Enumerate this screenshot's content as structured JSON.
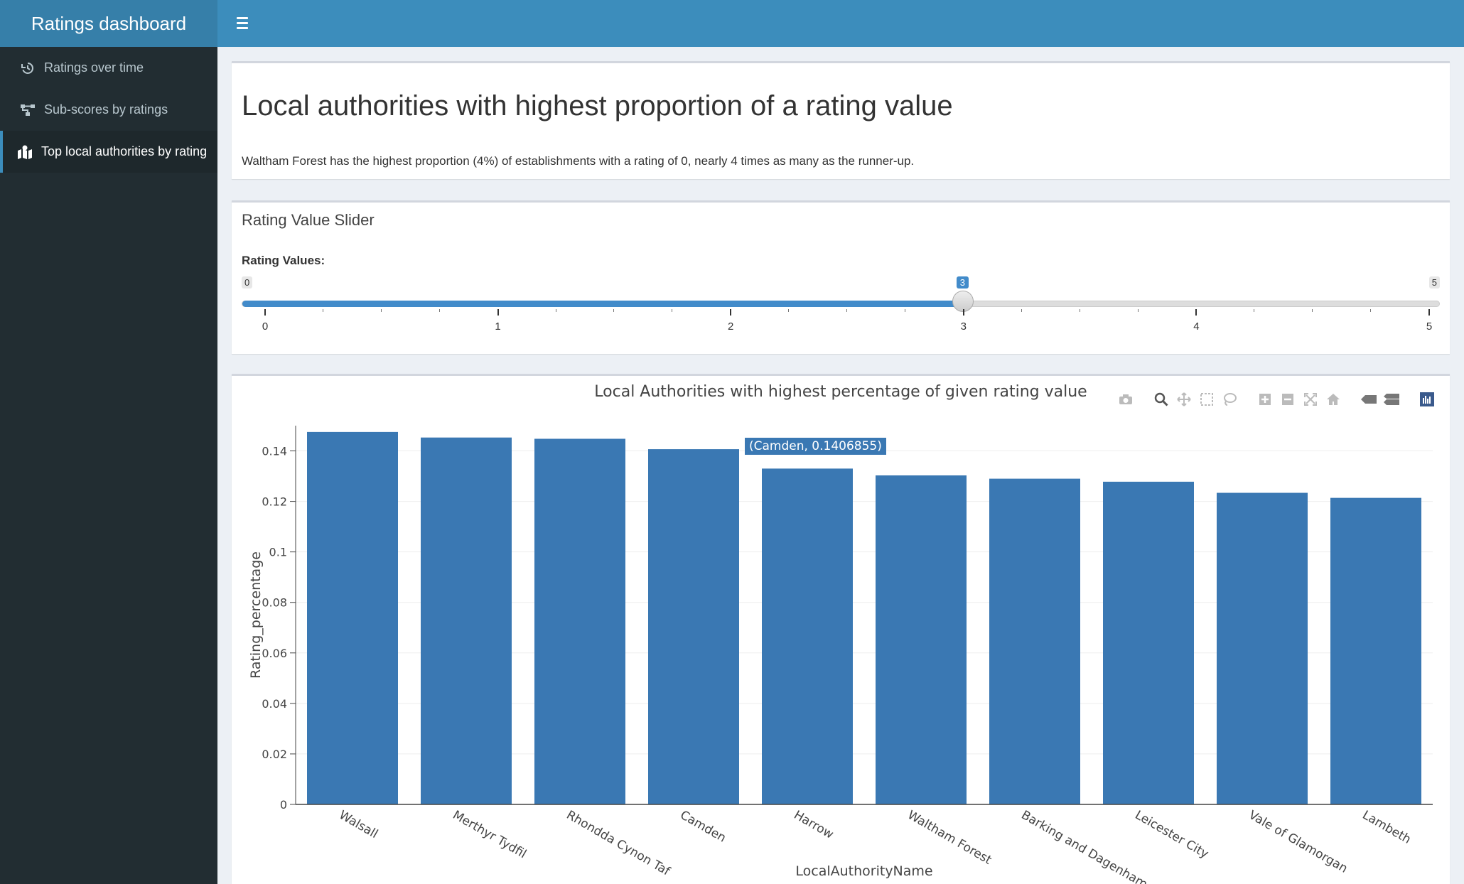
{
  "header": {
    "app_title": "Ratings dashboard",
    "menu_icon": "hamburger-icon",
    "color": "#3c8dbc"
  },
  "sidebar": {
    "items": [
      {
        "label": "Ratings over time",
        "icon": "history-icon",
        "active": false
      },
      {
        "label": "Sub-scores by ratings",
        "icon": "sitemap-icon",
        "active": false
      },
      {
        "label": "Top local authorities by rating",
        "icon": "map-marked-icon",
        "active": true
      }
    ]
  },
  "summary": {
    "title": "Local authorities with highest proportion of a rating value",
    "description": "Waltham Forest has the highest proportion (4%) of establishments with a rating of 0, nearly 4 times as many as the runner-up."
  },
  "slider": {
    "box_title": "Rating Value Slider",
    "label": "Rating Values:",
    "min": 0,
    "max": 5,
    "value": 3,
    "min_label": "0",
    "max_label": "5",
    "value_label": "3",
    "ticks": [
      "0",
      "1",
      "2",
      "3",
      "4",
      "5"
    ]
  },
  "toolbar": {
    "icons": [
      "camera-icon",
      "zoom-icon",
      "pan-icon",
      "box-select-icon",
      "lasso-icon",
      "zoom-in-icon",
      "zoom-out-icon",
      "autoscale-icon",
      "reset-axes-icon",
      "spike-lines-icon",
      "compare-hover-icon",
      "plotly-logo-icon"
    ]
  },
  "tooltip": {
    "text": "(Camden, 0.1406855)"
  },
  "chart_data": {
    "type": "bar",
    "title": "Local Authorities with highest percentage of given rating value",
    "xlabel": "LocalAuthorityName",
    "ylabel": "Rating_percentage",
    "ylim": [
      0,
      0.15
    ],
    "yticks": [
      "0",
      "0.02",
      "0.04",
      "0.06",
      "0.08",
      "0.1",
      "0.12",
      "0.14"
    ],
    "grid": true,
    "bar_color": "#3a78b3",
    "categories": [
      "Walsall",
      "Merthyr Tydfil",
      "Rhondda Cynon Taf",
      "Camden",
      "Harrow",
      "Waltham Forest",
      "Barking and Dagenham",
      "Leicester City",
      "Vale of Glamorgan",
      "Lambeth"
    ],
    "values": [
      0.1475,
      0.1453,
      0.1448,
      0.1406855,
      0.133,
      0.1303,
      0.129,
      0.1278,
      0.1234,
      0.1214
    ]
  }
}
